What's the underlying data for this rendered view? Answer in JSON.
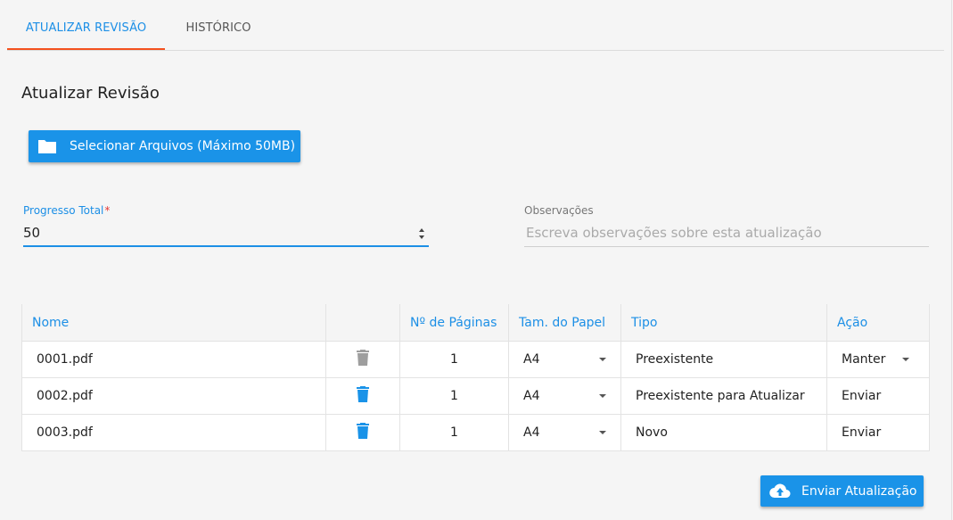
{
  "tabs": [
    {
      "label": "ATUALIZAR REVISÃO",
      "active": true
    },
    {
      "label": "HISTÓRICO",
      "active": false
    }
  ],
  "section": {
    "title": "Atualizar Revisão"
  },
  "upload_button": {
    "label": "Selecionar Arquivos (Máximo 50MB)",
    "icon": "folder-icon"
  },
  "progress": {
    "label": "Progresso Total",
    "required_mark": "*",
    "value": "50"
  },
  "observations": {
    "label": "Observações",
    "placeholder": "Escreva observações sobre esta atualização"
  },
  "table": {
    "headers": [
      "Nome",
      "",
      "Nº de Páginas",
      "Tam. do Papel",
      "Tipo",
      "Ação"
    ],
    "rows": [
      {
        "name": "0001.pdf",
        "delete_enabled": false,
        "pages": "1",
        "paper": "A4",
        "type": "Preexistente",
        "action": "Manter",
        "action_is_select": true
      },
      {
        "name": "0002.pdf",
        "delete_enabled": true,
        "pages": "1",
        "paper": "A4",
        "type": "Preexistente para Atualizar",
        "action": "Enviar",
        "action_is_select": false
      },
      {
        "name": "0003.pdf",
        "delete_enabled": true,
        "pages": "1",
        "paper": "A4",
        "type": "Novo",
        "action": "Enviar",
        "action_is_select": false
      }
    ]
  },
  "send_button": {
    "label": "Enviar Atualização",
    "icon": "cloud-upload-icon"
  },
  "colors": {
    "primary": "#1a93e8",
    "tab_indicator": "#f4511e",
    "disabled_icon": "#9e9e9e"
  }
}
